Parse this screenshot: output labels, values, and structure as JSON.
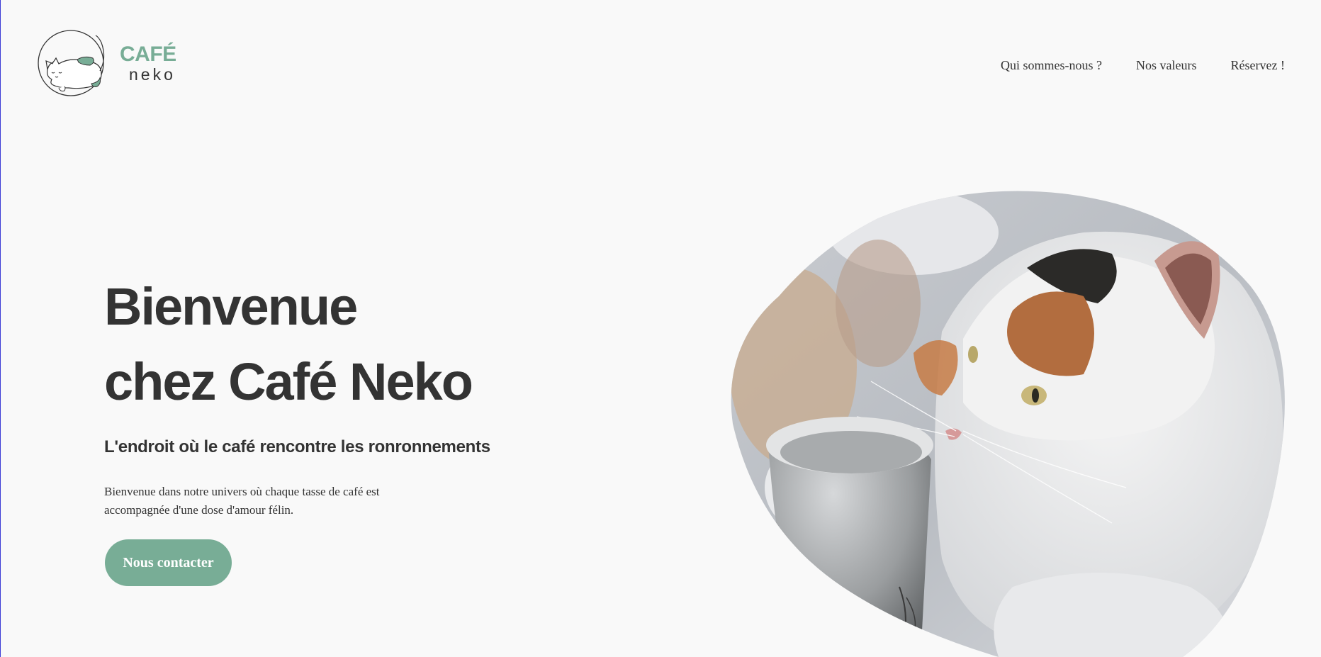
{
  "brand": {
    "name_top": "CAFÉ",
    "name_bottom": "neko",
    "logo_icon": "sleeping-cat-in-circle-icon",
    "accent_color": "#78ad96",
    "text_color": "#333333",
    "background_color": "#f9f9f9"
  },
  "nav": {
    "items": [
      {
        "label": "Qui sommes-nous ?"
      },
      {
        "label": "Nos valeurs"
      },
      {
        "label": "Réservez !"
      }
    ]
  },
  "hero": {
    "title_line1": "Bienvenue",
    "title_line2": "chez Café Neko",
    "subtitle": "L'endroit où le café rencontre les ronronnements",
    "description": "Bienvenue dans notre univers où chaque tasse de café est accompagnée d'une dose d'amour félin.",
    "cta_label": "Nous contacter",
    "image_subject": "calico-cat-sniffing-coffee-cup-photo"
  }
}
